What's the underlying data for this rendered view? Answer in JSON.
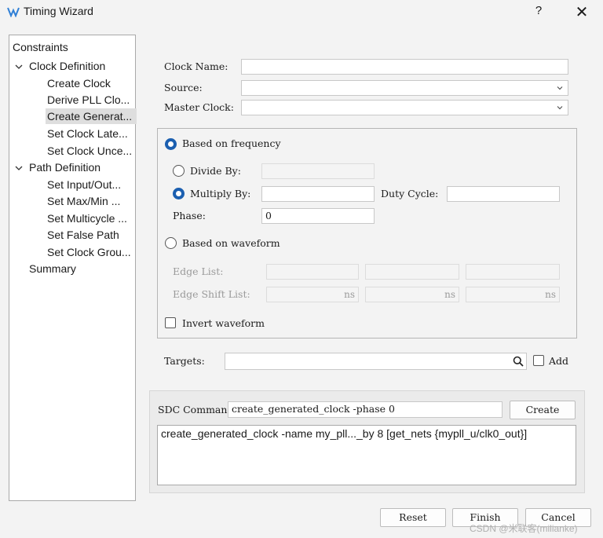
{
  "window": {
    "title": "Timing Wizard",
    "help": "?",
    "close": "✕"
  },
  "tree": {
    "root": "Constraints",
    "groups": [
      {
        "label": "Clock Definition",
        "items": [
          "Create Clock",
          "Derive PLL Clo...",
          "Create Generat...",
          "Set Clock Late...",
          "Set Clock Unce..."
        ]
      },
      {
        "label": "Path Definition",
        "items": [
          "Set Input/Out...",
          "Set Max/Min ...",
          "Set Multicycle ...",
          "Set False Path",
          "Set Clock Grou..."
        ]
      }
    ],
    "summary": "Summary",
    "selected": "Create Generat..."
  },
  "form": {
    "clock_name_label": "Clock Name:",
    "clock_name_value": "",
    "source_label": "Source:",
    "source_value": "",
    "master_clock_label": "Master Clock:",
    "master_clock_value": "",
    "based_on_frequency": "Based on frequency",
    "divide_by_label": "Divide By:",
    "divide_by_value": "",
    "multiply_by_label": "Multiply By:",
    "multiply_by_value": "",
    "duty_cycle_label": "Duty Cycle:",
    "duty_cycle_value": "",
    "phase_label": "Phase:",
    "phase_value": "0",
    "based_on_waveform": "Based on waveform",
    "edge_list_label": "Edge List:",
    "edge_shift_label": "Edge Shift List:",
    "ns_unit": "ns",
    "invert_waveform": "Invert waveform",
    "targets_label": "Targets:",
    "targets_value": "",
    "add_label": "Add"
  },
  "sdc": {
    "label": "SDC Command:",
    "value": "create_generated_clock -phase 0",
    "create_button": "Create",
    "preview": "create_generated_clock -name my_pll..._by 8 [get_nets {mypll_u/clk0_out}]"
  },
  "buttons": {
    "reset": "Reset",
    "finish": "Finish",
    "cancel": "Cancel"
  },
  "watermark": "CSDN @米联客(milianke)",
  "colors": {
    "accent": "#1b5fb0",
    "selection": "#dedede"
  }
}
